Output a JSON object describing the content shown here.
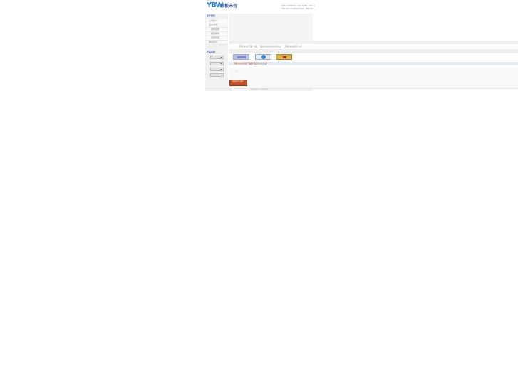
{
  "header": {
    "logo_mark": "YBW",
    "logo_name": "银板未谷",
    "contact_line_1": "WELCOME TO OUR SITE · 0571-",
    "contact_line_2": "TEL 0571-XXXXXXXX · 86XXX"
  },
  "sidebar": {
    "about_heading": "关于我们",
    "items": [
      "公司简介",
      "企业文化",
      "荣誉资质",
      "组织架构",
      "发展历程",
      "联系我们"
    ],
    "products_heading": "产品系列",
    "buttons": [
      "产品一",
      "产品二",
      "产品三",
      "产品四"
    ]
  },
  "main": {
    "links": [
      "银板未谷产品介绍",
      "银板未谷企业新闻中心",
      "银板未谷联系方式"
    ],
    "thumb_captions": [
      "银板未谷特色产品展示",
      "银板未谷新品"
    ],
    "promo_text": "银板未谷产品推广"
  },
  "footer": {
    "copyright": "Copyright © 2009-2010"
  },
  "colors": {
    "accent": "#3563a7",
    "sidebar_bg": "#f1f1f1",
    "promo_bg": "#c0502b"
  }
}
